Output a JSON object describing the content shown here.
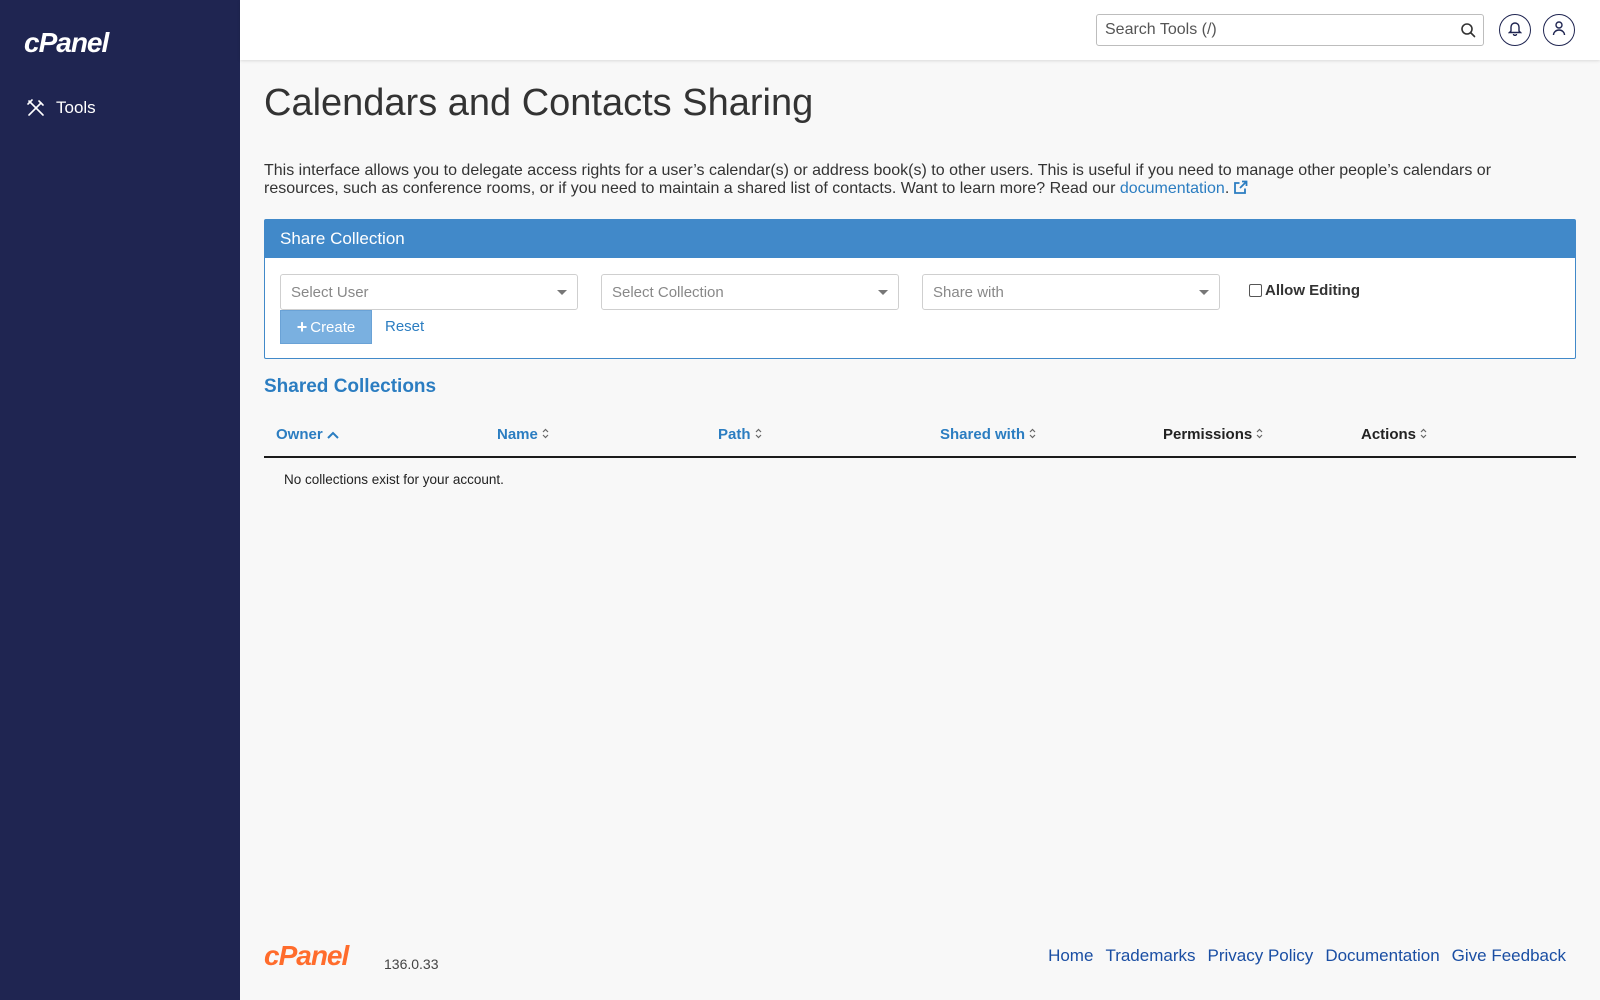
{
  "sidebar": {
    "logo_text": "cPanel",
    "items": [
      {
        "label": "Tools",
        "icon": "tools-icon"
      }
    ]
  },
  "header": {
    "search_placeholder": "Search Tools (/)",
    "notifications_icon": "bell-icon",
    "user_icon": "user-icon"
  },
  "page": {
    "title": "Calendars and Contacts Sharing",
    "intro_text": "This interface allows you to delegate access rights for a user’s calendar(s) or address book(s) to other users. This is useful if you need to manage other people’s calendars or resources, such as conference rooms, or if you need to maintain a shared list of contacts. Want to learn more? Read our ",
    "doc_link_text": "documentation",
    "intro_end": "."
  },
  "share_panel": {
    "title": "Share Collection",
    "select_user_placeholder": "Select User",
    "select_collection_placeholder": "Select Collection",
    "share_with_placeholder": "Share with",
    "allow_editing_label": "Allow Editing",
    "allow_editing_checked": false,
    "create_label": "Create",
    "reset_label": "Reset"
  },
  "shared_collections": {
    "title": "Shared Collections",
    "columns": [
      "Owner",
      "Name",
      "Path",
      "Shared with",
      "Permissions",
      "Actions"
    ],
    "sorted_column": "Owner",
    "sort_direction": "ascending",
    "empty_message": "No collections exist for your account.",
    "rows": []
  },
  "footer": {
    "logo_text": "cPanel",
    "version": "136.0.33",
    "links": [
      "Home",
      "Trademarks",
      "Privacy Policy",
      "Documentation",
      "Give Feedback"
    ]
  },
  "colors": {
    "sidebar_bg": "#1f2551",
    "accent_blue": "#4189c9",
    "link_blue": "#2b7dc1",
    "brand_orange": "#ff6c2c"
  }
}
